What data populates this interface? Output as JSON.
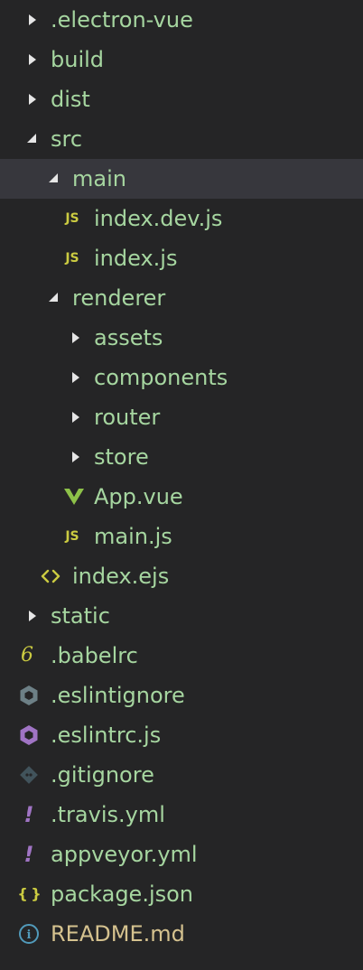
{
  "explorer": {
    "items": [
      {
        "label": ".electron-vue",
        "type": "folder",
        "expanded": false,
        "depth": 0,
        "icon": "chevron-right-icon"
      },
      {
        "label": "build",
        "type": "folder",
        "expanded": false,
        "depth": 0,
        "icon": "chevron-right-icon"
      },
      {
        "label": "dist",
        "type": "folder",
        "expanded": false,
        "depth": 0,
        "icon": "chevron-right-icon"
      },
      {
        "label": "src",
        "type": "folder",
        "expanded": true,
        "depth": 0,
        "icon": "chevron-down-icon"
      },
      {
        "label": "main",
        "type": "folder",
        "expanded": true,
        "depth": 1,
        "icon": "chevron-down-icon",
        "selected": true
      },
      {
        "label": "index.dev.js",
        "type": "file",
        "depth": 2,
        "icon": "javascript-icon",
        "icon_text": "JS"
      },
      {
        "label": "index.js",
        "type": "file",
        "depth": 2,
        "icon": "javascript-icon",
        "icon_text": "JS"
      },
      {
        "label": "renderer",
        "type": "folder",
        "expanded": true,
        "depth": 1,
        "icon": "chevron-down-icon"
      },
      {
        "label": "assets",
        "type": "folder",
        "expanded": false,
        "depth": 2,
        "icon": "chevron-right-icon"
      },
      {
        "label": "components",
        "type": "folder",
        "expanded": false,
        "depth": 2,
        "icon": "chevron-right-icon"
      },
      {
        "label": "router",
        "type": "folder",
        "expanded": false,
        "depth": 2,
        "icon": "chevron-right-icon"
      },
      {
        "label": "store",
        "type": "folder",
        "expanded": false,
        "depth": 2,
        "icon": "chevron-right-icon"
      },
      {
        "label": "App.vue",
        "type": "file",
        "depth": 2,
        "icon": "vue-icon"
      },
      {
        "label": "main.js",
        "type": "file",
        "depth": 2,
        "icon": "javascript-icon",
        "icon_text": "JS"
      },
      {
        "label": "index.ejs",
        "type": "file",
        "depth": 1,
        "icon": "html-template-icon",
        "icon_text": "<>"
      },
      {
        "label": "static",
        "type": "folder",
        "expanded": false,
        "depth": 0,
        "icon": "chevron-right-icon"
      },
      {
        "label": ".babelrc",
        "type": "file",
        "depth": 0,
        "icon": "babel-icon",
        "icon_text": "6"
      },
      {
        "label": ".eslintignore",
        "type": "file",
        "depth": 0,
        "icon": "eslint-ignore-icon"
      },
      {
        "label": ".eslintrc.js",
        "type": "file",
        "depth": 0,
        "icon": "eslint-icon"
      },
      {
        "label": ".gitignore",
        "type": "file",
        "depth": 0,
        "icon": "git-icon"
      },
      {
        "label": ".travis.yml",
        "type": "file",
        "depth": 0,
        "icon": "yaml-icon",
        "icon_text": "!"
      },
      {
        "label": "appveyor.yml",
        "type": "file",
        "depth": 0,
        "icon": "yaml-icon",
        "icon_text": "!"
      },
      {
        "label": "package.json",
        "type": "file",
        "depth": 0,
        "icon": "json-icon",
        "icon_text": "{ }"
      },
      {
        "label": "README.md",
        "type": "file",
        "depth": 0,
        "icon": "info-icon",
        "icon_text": "i"
      }
    ]
  },
  "colors": {
    "background": "#252526",
    "selected_row": "#37373d",
    "label": "#a6d6a0",
    "readme_label": "#d5c28f",
    "js_icon": "#cbcb41",
    "vue_icon": "#8dc149",
    "ejs_icon": "#cbcb41",
    "babel_icon": "#cbcb41",
    "eslint_ignore_icon": "#6d8086",
    "eslint_icon": "#a074c4",
    "git_icon": "#41535b",
    "yaml_icon": "#a074c4",
    "json_icon": "#cbcb41",
    "info_icon": "#519aba"
  }
}
